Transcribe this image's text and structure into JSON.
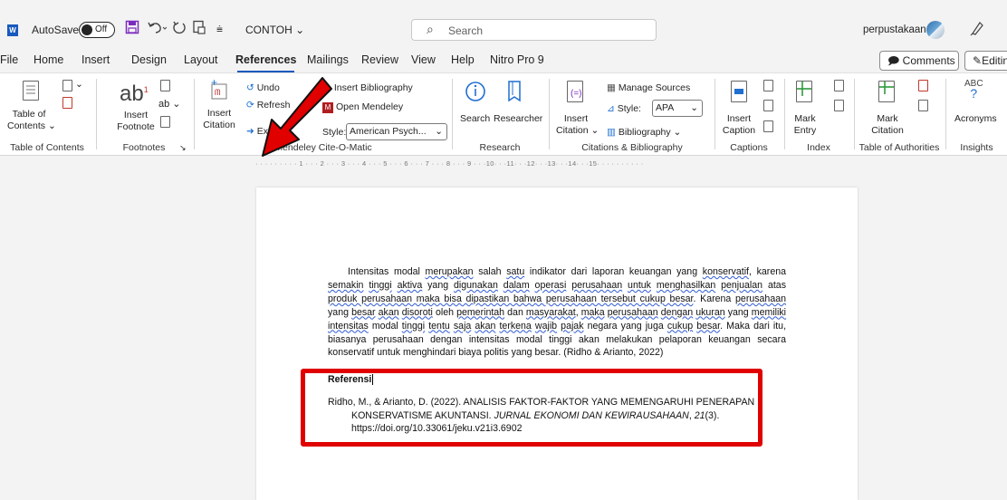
{
  "titlebar": {
    "app_badge": "W",
    "autosave_label": "AutoSave",
    "autosave_state": "Off",
    "doc_name": "CONTOH ⌄",
    "search_placeholder": "Search",
    "user_name": "perpustakaan"
  },
  "menu": [
    "File",
    "Home",
    "Insert",
    "Design",
    "Layout",
    "References",
    "Mailings",
    "Review",
    "View",
    "Help",
    "Nitro Pro 9"
  ],
  "menu_active": "References",
  "actions": {
    "comments": "Comments",
    "editing": "Editin"
  },
  "ribbon": {
    "toc": {
      "label_line1": "Table of",
      "label_line2": "Contents ⌄",
      "group": "Table of Contents"
    },
    "footnotes": {
      "icon_text": "ab",
      "label_line1": "Insert",
      "label_line2": "Footnote",
      "group": "Footnotes"
    },
    "mendeley": {
      "insert_citation_1": "Insert",
      "insert_citation_2": "Citation",
      "undo": "Undo",
      "refresh": "Refresh",
      "export": "Export ⌄",
      "insert_bibliography": "Insert Bibliography",
      "open_mendeley": "Open Mendeley",
      "style_label": "Style:",
      "style_value": "American Psych...",
      "group": "Mendeley Cite-O-Matic"
    },
    "research": {
      "search": "Search",
      "researcher": "Researcher",
      "group": "Research"
    },
    "citations": {
      "insert_citation_1": "Insert",
      "insert_citation_2": "Citation ⌄",
      "manage_sources": "Manage Sources",
      "style_label": "Style:",
      "style_value": "APA",
      "bibliography": "Bibliography ⌄",
      "group": "Citations & Bibliography"
    },
    "captions": {
      "label_line1": "Insert",
      "label_line2": "Caption",
      "group": "Captions"
    },
    "index": {
      "label_line1": "Mark",
      "label_line2": "Entry",
      "group": "Index"
    },
    "authorities": {
      "label_line1": "Mark",
      "label_line2": "Citation",
      "group": "Table of Authorities"
    },
    "insights": {
      "icon_line1": "ABC",
      "icon_line2": "?",
      "label": "Acronyms",
      "group": "Insights"
    }
  },
  "ruler": "· · · · · · · · · 1 · · · 2 · · · 3 · · · 4 · · · 5 · · · 6 · · · 7 · · · 8 · · · 9 · · ·10· · ·11· · ·12· · ·13· · ·14· · ·15· · · · · · · · · ·",
  "document": {
    "paragraph": {
      "t1": "Intensitas modal ",
      "u1": "merupakan",
      "t2": " salah ",
      "u2": "satu",
      "t3": " indikator dari laporan keuangan yang ",
      "u3": "konservatif",
      "t4": ", karena ",
      "u4": "semakin",
      "t5": " ",
      "u5": "tinggi",
      "t6": " ",
      "u6": "aktiva",
      "t7": " yang ",
      "u7": "digunakan",
      "t8": " ",
      "u8": "dalam",
      "t9": " ",
      "u9": "operasi",
      "t10": " ",
      "u10": "perusahaan",
      "t11": " ",
      "u11": "untuk",
      "t12": " ",
      "u12": "menghasilkan",
      "t13": " ",
      "u13": "penjualan",
      "t14": " atas ",
      "u14": "produk perusahaan maka bisa dipastikan bahwa perusahaan tersebut cukup besar",
      "t15": ". Karena ",
      "u15": "perusahaan",
      "t16": " yang ",
      "u16": "besar",
      "t17": " ",
      "u17": "akan",
      "t18": " ",
      "u18": "disoroti",
      "t19": " oleh ",
      "u19": "pemerintah",
      "t20": " dan ",
      "u20": "masyarakat",
      "t21": ", ",
      "u21": "maka",
      "t22": " ",
      "u22": "perusahaan",
      "t23": " ",
      "u23": "dengan",
      "t24": " ",
      "u24": "ukuran",
      "t25": " yang ",
      "u25": "memiliki",
      "t26": " ",
      "u26": "intensitas",
      "t27": " modal ",
      "u27": "tinggi",
      "t28": " ",
      "u28": "tentu",
      "t29": " ",
      "u29": "saja",
      "t30": " ",
      "u30": "akan",
      "t31": " ",
      "u31": "terkena",
      "t32": " ",
      "u32": "wajib",
      "t33": " ",
      "u33": "pajak",
      "t34": " negara yang juga ",
      "u34": "cukup",
      "t35": " ",
      "u35": "besar",
      "t36": ". Maka dari itu, biasanya perusahaan dengan intensitas modal tinggi akan melakukan pelaporan keuangan secara konservatif untuk menghindari biaya politis yang besar. (Ridho & Arianto, 2022)"
    },
    "ref_heading": "Referensi",
    "ref_line1": "Ridho, M., & Arianto, D. (2022). ANALISIS FAKTOR-FAKTOR YANG MEMENGARUHI PENERAPAN",
    "ref_line2a": "KONSERVATISME AKUNTANSI. ",
    "ref_journal": "JURNAL EKONOMI DAN KEWIRAUSAHAAN",
    "ref_line2b": ", ",
    "ref_volume": "21",
    "ref_line2c": "(3).",
    "ref_line3": "https://doi.org/10.33061/jeku.v21i3.6902"
  },
  "colors": {
    "accent": "#185abd",
    "highlight": "#e00000",
    "mendeley_red": "#b01d21"
  }
}
